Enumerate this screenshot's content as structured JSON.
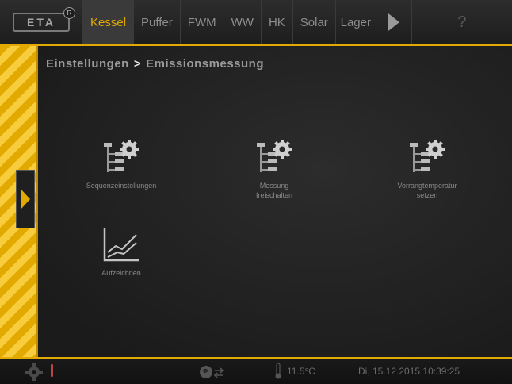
{
  "logo": {
    "text": "ETA",
    "registered": "R"
  },
  "tabs": [
    {
      "label": "Kessel",
      "active": true
    },
    {
      "label": "Puffer",
      "active": false
    },
    {
      "label": "FWM",
      "active": false
    },
    {
      "label": "WW",
      "active": false
    },
    {
      "label": "HK",
      "active": false
    },
    {
      "label": "Solar",
      "active": false
    },
    {
      "label": "Lager",
      "active": false
    }
  ],
  "help_label": "?",
  "breadcrumb": {
    "parent": "Einstellungen",
    "separator": ">",
    "current": "Emissionsmessung"
  },
  "tiles": [
    {
      "label": "Sequenzeinstellungen",
      "icon": "settings-tree-icon"
    },
    {
      "label": "Messung\nfreischalten",
      "icon": "settings-tree-icon"
    },
    {
      "label": "Vorrangtemperatur\nsetzen",
      "icon": "settings-tree-icon"
    },
    {
      "label": "Aufzeichnen",
      "icon": "line-chart-icon"
    }
  ],
  "status": {
    "temperature": "11.5°C",
    "datetime": "Di, 15.12.2015 10:39:25"
  },
  "colors": {
    "accent": "#e2a900",
    "background": "#1a1a1a",
    "alert": "#b44444"
  }
}
